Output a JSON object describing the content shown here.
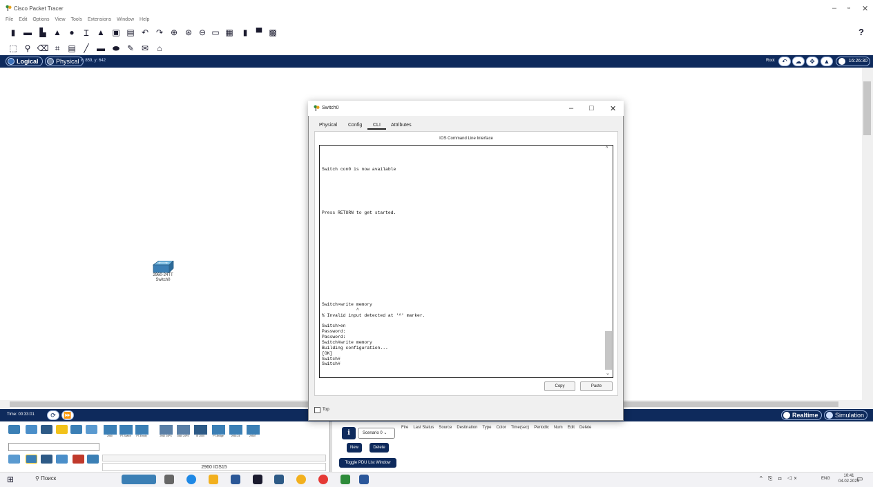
{
  "app": {
    "title": "Cisco Packet Tracer",
    "menu": [
      "File",
      "Edit",
      "Options",
      "View",
      "Tools",
      "Extensions",
      "Window",
      "Help"
    ],
    "help_glyph": "?"
  },
  "workspace": {
    "logical_label": "Logical",
    "physical_label": "Physical",
    "coords": "x: 859, y: 642",
    "root_label": "Root",
    "clock": "16:26:30"
  },
  "canvas": {
    "device": {
      "model": "2960-24TT",
      "name": "Switch0"
    }
  },
  "timebar": {
    "time": "Time: 00:33:01",
    "realtime_label": "Realtime",
    "simulation_label": "Simulation"
  },
  "device_picker": {
    "devices": [
      "2960",
      "PT-Switch",
      "PT-Empty",
      "2960 24PS",
      "3560 24PS",
      "IE 2000",
      "PT-Bridge",
      "2950-24",
      "2950T"
    ],
    "status": "2960 IOS15"
  },
  "scenario": {
    "selected": "Scenario 0",
    "new_label": "New",
    "delete_label": "Delete",
    "toggle_label": "Toggle PDU List Window",
    "columns": [
      "Fire",
      "Last Status",
      "Source",
      "Destination",
      "Type",
      "Color",
      "Time(sec)",
      "Periodic",
      "Num",
      "Edit",
      "Delete"
    ]
  },
  "dialog": {
    "title": "Switch0",
    "tabs": [
      "Physical",
      "Config",
      "CLI",
      "Attributes"
    ],
    "active_tab": "CLI",
    "heading": "IOS Command Line Interface",
    "terminal_lines": [
      "Switch con0 is now available",
      "",
      "",
      "",
      "",
      "",
      "",
      "",
      "Press RETURN to get started.",
      "",
      "",
      "",
      "",
      "",
      "",
      "",
      "",
      "",
      "",
      "",
      "",
      "",
      "",
      "",
      "",
      "Switch>write memory",
      "             ^",
      "% Invalid input detected at '^' marker.",
      "",
      "Switch>en",
      "Password:",
      "Password:",
      "Switch#write memory",
      "Building configuration...",
      "[OK]",
      "Switch#",
      "Switch#"
    ],
    "copy_label": "Copy",
    "paste_label": "Paste",
    "top_label": "Top"
  },
  "taskbar": {
    "search_placeholder": "Поиск",
    "lang": "ENG",
    "time": "10:41",
    "date": "04.02.2025"
  },
  "colors": {
    "workspace_bar": "#0e2a5c",
    "dialog_bg": "#f0f0f0"
  }
}
